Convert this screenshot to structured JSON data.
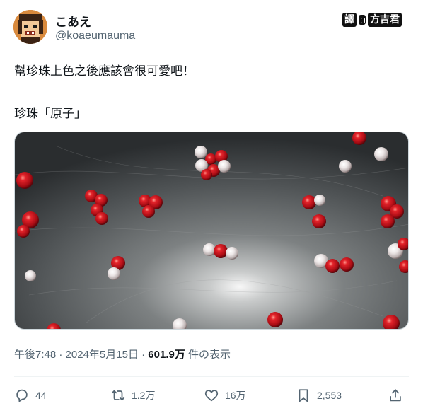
{
  "author": {
    "display_name": "こあえ",
    "handle": "@koaeumauma"
  },
  "credit": {
    "part1": "譯",
    "part2": "方吉君"
  },
  "tweet": {
    "line1": "幫珍珠上色之後應該會很可愛吧！",
    "line2": "珍珠「原子」"
  },
  "meta": {
    "time": "午後7:48",
    "sep1": "·",
    "date": "2024年5月15日",
    "sep2": "·",
    "views": "601.9万",
    "views_suffix": "件の表示"
  },
  "actions": {
    "reply": {
      "icon": "reply-icon",
      "count": "44"
    },
    "retweet": {
      "icon": "retweet-icon",
      "count": "1.2万"
    },
    "like": {
      "icon": "heart-icon",
      "count": "16万"
    },
    "bookmark": {
      "icon": "bookmark-icon",
      "count": "2,553"
    },
    "share": {
      "icon": "share-icon"
    }
  },
  "colors": {
    "text_primary": "#0f1419",
    "text_secondary": "#536471",
    "pearl_red": "#c0141c",
    "pearl_white": "#e9e4e4",
    "tray_gray": "#5c6062"
  }
}
